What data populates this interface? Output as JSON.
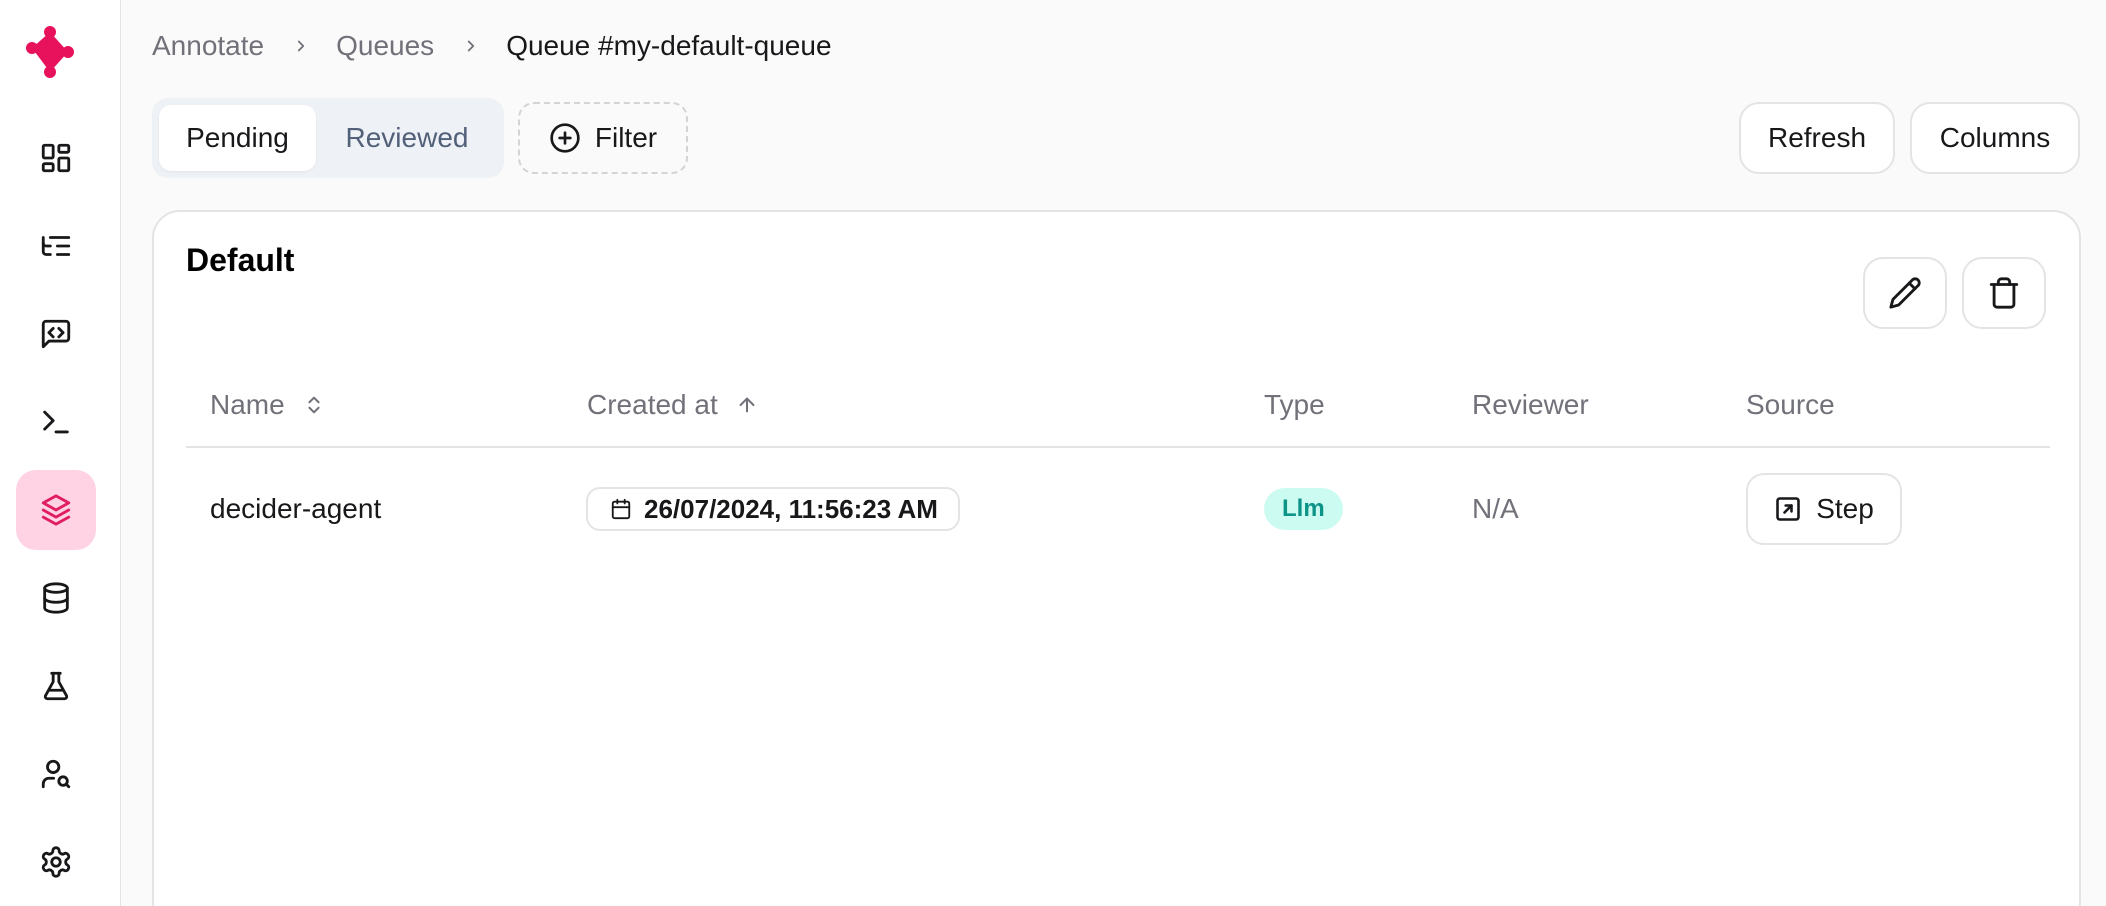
{
  "sidebar": {
    "logo": "app-logo",
    "items": [
      {
        "name": "dashboard",
        "icon": "layout-dashboard-icon",
        "active": false
      },
      {
        "name": "threads",
        "icon": "list-tree-icon",
        "active": false
      },
      {
        "name": "feedback",
        "icon": "message-code-icon",
        "active": false
      },
      {
        "name": "playground",
        "icon": "terminal-icon",
        "active": false
      },
      {
        "name": "annotate",
        "icon": "layers-icon",
        "active": true
      },
      {
        "name": "datasets",
        "icon": "database-icon",
        "active": false
      },
      {
        "name": "experiments",
        "icon": "flask-icon",
        "active": false
      },
      {
        "name": "users",
        "icon": "user-search-icon",
        "active": false
      },
      {
        "name": "settings",
        "icon": "settings-icon",
        "active": false
      }
    ]
  },
  "breadcrumb": {
    "items": [
      "Annotate",
      "Queues"
    ],
    "current": "Queue #my-default-queue"
  },
  "tabs": {
    "pending": "Pending",
    "reviewed": "Reviewed",
    "active": "Pending"
  },
  "toolbar": {
    "filter_label": "Filter",
    "refresh_label": "Refresh",
    "columns_label": "Columns"
  },
  "queue": {
    "title": "Default"
  },
  "table": {
    "columns": {
      "name": "Name",
      "created_at": "Created at",
      "type": "Type",
      "reviewer": "Reviewer",
      "source": "Source"
    },
    "rows": [
      {
        "name": "decider-agent",
        "created_at": "26/07/2024, 11:56:23 AM",
        "type": "Llm",
        "reviewer": "N/A",
        "source": "Step"
      }
    ]
  },
  "colors": {
    "brand": "#e11d62",
    "active_bg": "#ffd3e4",
    "badge_bg": "#ccfbf1",
    "badge_text": "#0d9488"
  }
}
